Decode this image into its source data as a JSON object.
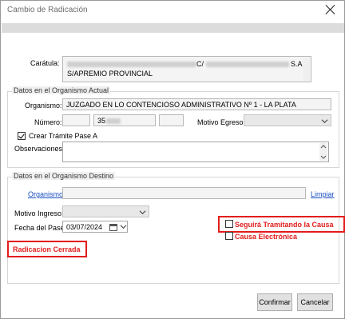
{
  "window": {
    "title": "Cambio de Radicación"
  },
  "caratula": {
    "label": "Carátula:",
    "line1_suffix": "C/",
    "line1_end": "S.A.",
    "line2": "S/APREMIO PROVINCIAL"
  },
  "actual": {
    "group_title": "Datos en el Organismo Actual",
    "organismo_label": "Organismo:",
    "organismo_value": "JUZGADO EN LO CONTENCIOSO ADMINISTRATIVO Nº 1 - LA PLATA",
    "numero_label": "Número:",
    "numero_value": "35",
    "motivo_egreso_label": "Motivo Egreso:",
    "crear_tramite_label": "Crear Trámite Pase A",
    "observaciones_label": "Observaciones:"
  },
  "destino": {
    "group_title": "Datos en el Organismo Destino",
    "organismo_link": "Organismo",
    "limpiar_link": "Limpiar",
    "motivo_ingreso_label": "Motivo Ingreso:",
    "fecha_pase_label": "Fecha del Pase:",
    "fecha_pase_value": "03/07/2024",
    "seguira_label": "Seguirá Tramitando la Causa",
    "causa_electronica_label": "Causa Electrónica",
    "radicacion_cerrada": "Radicacion Cerrada"
  },
  "buttons": {
    "confirmar": "Confirmar",
    "cancelar": "Cancelar"
  },
  "colors": {
    "highlight": "#e31c1c",
    "link": "#1a4fc4",
    "window_bg": "#f0f0f0"
  },
  "icons": [
    "close-icon",
    "chevron-down-icon",
    "calendar-icon",
    "scroll-up-icon",
    "scroll-down-icon",
    "check-icon"
  ]
}
